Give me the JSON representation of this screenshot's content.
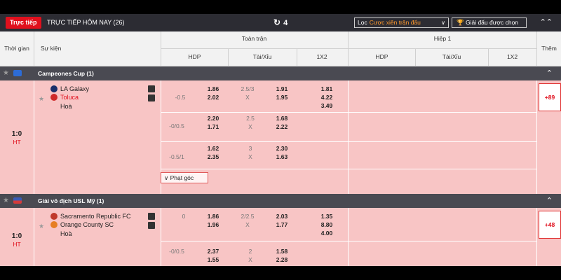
{
  "topbar": {
    "live_badge": "Trực tiếp",
    "title": "TRỰC TIẾP HÔM NAY (26)",
    "refresh_icon": "refresh-icon",
    "refresh_count": "4",
    "filter_label": "Lọc",
    "filter_value": "Cược xiên trận đấu",
    "league_select": "Giải đấu được chọn",
    "colors": {
      "bg": "#2c2c33",
      "badge": "#e0101d",
      "filter_value": "#ff9a2e"
    }
  },
  "header": {
    "time": "Thời gian",
    "event": "Sự kiện",
    "full_match": "Toàn trận",
    "first_half": "Hiệp 1",
    "more": "Thêm",
    "hdp": "HDP",
    "ou": "Tài/Xỉu",
    "x12": "1X2"
  },
  "leagues": [
    {
      "name": "Campeones Cup (1)",
      "match": {
        "time": "1:0",
        "status": "HT",
        "home": "LA Galaxy",
        "away": "Toluca",
        "draw": "Hoà",
        "more": "+89",
        "corner": "Phạt góc",
        "rows": [
          {
            "hdp": "-0.5",
            "hdp_home": "1.86",
            "hdp_away": "2.02",
            "ou_line": "2.5/3",
            "ou_x": "X",
            "ou_over": "1.91",
            "ou_under": "1.95",
            "x1": "1.81",
            "x2": "4.22",
            "xx": "3.49"
          },
          {
            "hdp": "-0/0.5",
            "hdp_home": "2.20",
            "hdp_away": "1.71",
            "ou_line": "2.5",
            "ou_x": "X",
            "ou_over": "1.68",
            "ou_under": "2.22"
          },
          {
            "hdp": "-0.5/1",
            "hdp_home": "1.62",
            "hdp_away": "2.35",
            "ou_line": "3",
            "ou_x": "X",
            "ou_over": "2.30",
            "ou_under": "1.63"
          }
        ]
      }
    },
    {
      "name": "Giải vô địch USL Mỹ (1)",
      "match": {
        "time": "1:0",
        "status": "HT",
        "home": "Sacramento Republic FC",
        "away": "Orange County SC",
        "draw": "Hoà",
        "more": "+48",
        "rows": [
          {
            "hdp": "0",
            "hdp_home": "1.86",
            "hdp_away": "1.96",
            "ou_line": "2/2.5",
            "ou_x": "X",
            "ou_over": "2.03",
            "ou_under": "1.77",
            "x1": "1.35",
            "x2": "8.80",
            "xx": "4.00"
          },
          {
            "hdp": "-0/0.5",
            "hdp_home": "2.37",
            "hdp_away": "1.55",
            "ou_line": "2",
            "ou_x": "X",
            "ou_over": "1.58",
            "ou_under": "2.28"
          }
        ]
      }
    }
  ]
}
